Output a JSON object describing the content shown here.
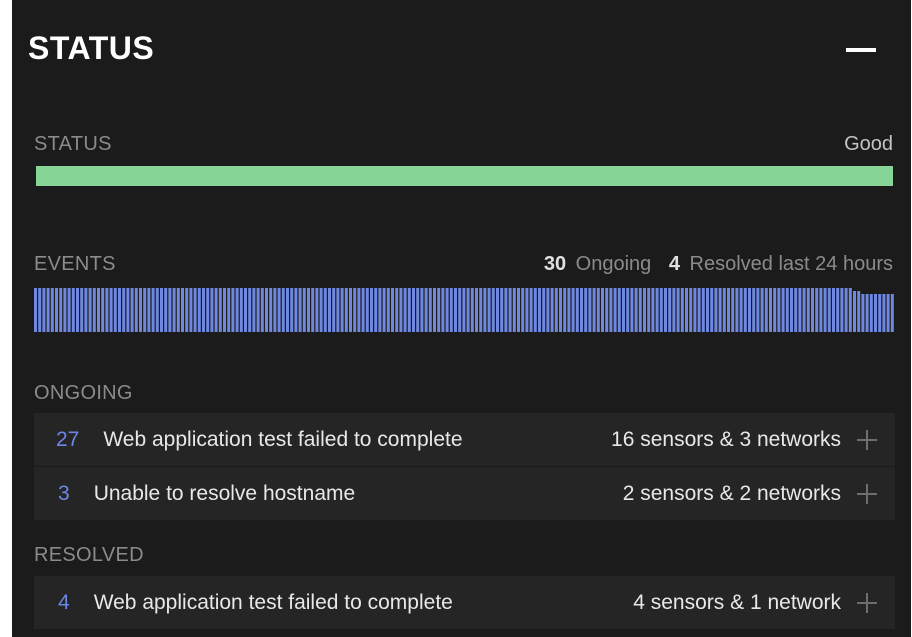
{
  "panel": {
    "title": "STATUS"
  },
  "status": {
    "label": "STATUS",
    "value": "Good",
    "bar_color": "#87d497",
    "level": 1.0
  },
  "events": {
    "label": "EVENTS",
    "ongoing_count": "30",
    "ongoing_label": "Ongoing",
    "resolved_count": "4",
    "resolved_label": "Resolved last 24 hours",
    "bar_color": "#6f88e0"
  },
  "ongoing": {
    "label": "ONGOING",
    "items": [
      {
        "count": "27",
        "description": "Web application test failed to complete",
        "scope": "16 sensors & 3 networks"
      },
      {
        "count": "3",
        "description": "Unable to resolve hostname",
        "scope": "2 sensors & 2 networks"
      }
    ]
  },
  "resolved": {
    "label": "RESOLVED",
    "items": [
      {
        "count": "4",
        "description": "Web application test failed to complete",
        "scope": "4 sensors & 1 network"
      }
    ]
  },
  "icons": {
    "collapse": "minus-icon",
    "expand": "plus-icon"
  }
}
